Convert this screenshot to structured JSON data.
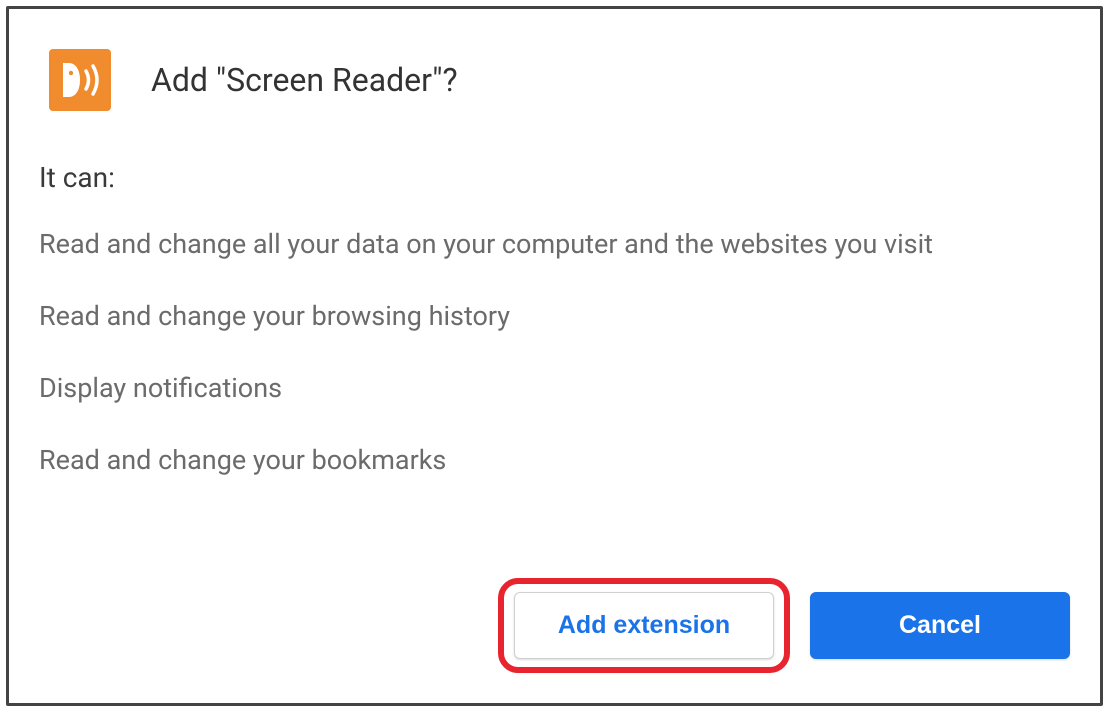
{
  "dialog": {
    "title": "Add \"Screen Reader\"?",
    "permissions_label": "It can:",
    "permissions": [
      "Read and change all your data on your computer and the websites you visit",
      "Read and change your browsing history",
      "Display notifications",
      "Read and change your bookmarks"
    ],
    "actions": {
      "confirm": "Add extension",
      "cancel": "Cancel"
    }
  },
  "colors": {
    "icon_bg": "#f08b2e",
    "primary_blue": "#1a73e8",
    "highlight_red": "#e8252e"
  }
}
